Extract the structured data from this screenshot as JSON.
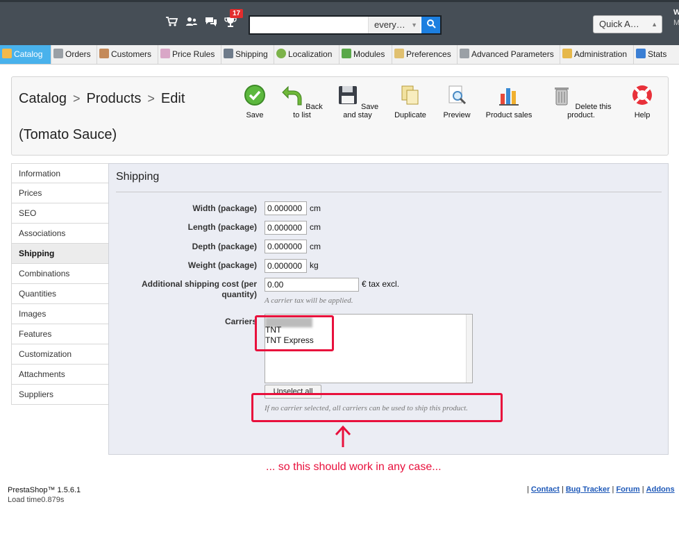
{
  "topbar": {
    "notification_count": "17",
    "search": {
      "value": "",
      "scope": "every…"
    },
    "quick_access": "Quick A…",
    "corner_text_1": "W",
    "corner_text_2": "M"
  },
  "tabs": [
    {
      "label": "Catalog",
      "active": true
    },
    {
      "label": "Orders"
    },
    {
      "label": "Customers"
    },
    {
      "label": "Price Rules"
    },
    {
      "label": "Shipping"
    },
    {
      "label": "Localization"
    },
    {
      "label": "Modules"
    },
    {
      "label": "Preferences"
    },
    {
      "label": "Advanced Parameters"
    },
    {
      "label": "Administration"
    },
    {
      "label": "Stats"
    }
  ],
  "breadcrumb": {
    "level1": "Catalog",
    "level2": "Products",
    "level3": "Edit",
    "sep": ">"
  },
  "product_name": "(Tomato Sauce)",
  "toolbar": {
    "save": "Save",
    "back_to_list": "Back to list",
    "save_and_stay": "Save and stay",
    "duplicate": "Duplicate",
    "preview": "Preview",
    "product_sales": "Product sales",
    "delete": "Delete this product.",
    "help": "Help"
  },
  "sidebar": [
    {
      "label": "Information"
    },
    {
      "label": "Prices"
    },
    {
      "label": "SEO"
    },
    {
      "label": "Associations"
    },
    {
      "label": "Shipping",
      "active": true
    },
    {
      "label": "Combinations"
    },
    {
      "label": "Quantities"
    },
    {
      "label": "Images"
    },
    {
      "label": "Features"
    },
    {
      "label": "Customization"
    },
    {
      "label": "Attachments"
    },
    {
      "label": "Suppliers"
    }
  ],
  "shipping": {
    "title": "Shipping",
    "width": {
      "label": "Width (package)",
      "value": "0.000000",
      "unit": "cm"
    },
    "length": {
      "label": "Length (package)",
      "value": "0.000000",
      "unit": "cm"
    },
    "depth": {
      "label": "Depth (package)",
      "value": "0.000000",
      "unit": "cm"
    },
    "weight": {
      "label": "Weight (package)",
      "value": "0.000000",
      "unit": "kg"
    },
    "additional_cost": {
      "label": "Additional shipping cost (per quantity)",
      "value": "0.00",
      "unit": "€ tax excl.",
      "hint": "A carrier tax will be applied."
    },
    "carriers": {
      "label": "Carriers",
      "options": [
        "TNT",
        "TNT Express"
      ],
      "unselect_label": "Unselect all",
      "hint": "If no carrier selected, all carriers can be used to ship this product."
    }
  },
  "annotation": {
    "text": "... so this should work in any case..."
  },
  "footer": {
    "version": "PrestaShop™ 1.5.6.1",
    "load_time": "Load time0.879s",
    "links": [
      "Contact",
      "Bug Tracker",
      "Forum",
      "Addons"
    ],
    "sep": "|"
  },
  "colors": {
    "accent": "#49b2ec",
    "annotation": "#e8103c",
    "topbar": "#464e56",
    "panel": "#ebedf4"
  }
}
